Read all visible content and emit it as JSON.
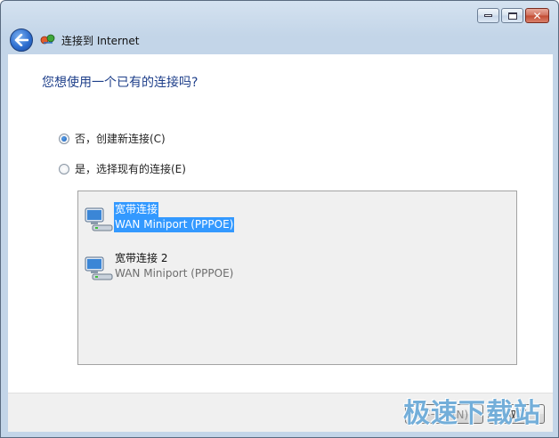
{
  "window": {
    "controls": {
      "minimize_icon": "minimize-icon",
      "maximize_icon": "maximize-icon",
      "close_icon": "close-icon"
    }
  },
  "nav": {
    "title": "连接到 Internet",
    "back_icon": "back-arrow-icon",
    "network_icon": "network-connection-icon"
  },
  "main": {
    "heading": "您想使用一个已有的连接吗?",
    "options": [
      {
        "label": "否，创建新连接(C)",
        "selected": true
      },
      {
        "label": "是，选择现有的连接(E)",
        "selected": false
      }
    ],
    "connections": [
      {
        "name": "宽带连接",
        "device": "WAN Miniport (PPPOE)",
        "selected": true
      },
      {
        "name": "宽带连接 2",
        "device": "WAN Miniport (PPPOE)",
        "selected": false
      }
    ]
  },
  "footer": {
    "next_label": "下一步(N)",
    "cancel_label": "取消"
  },
  "watermark": "极速下载站",
  "colors": {
    "heading": "#1e3f8a",
    "selection": "#3399ff",
    "watermark": "#5aa0d2"
  }
}
